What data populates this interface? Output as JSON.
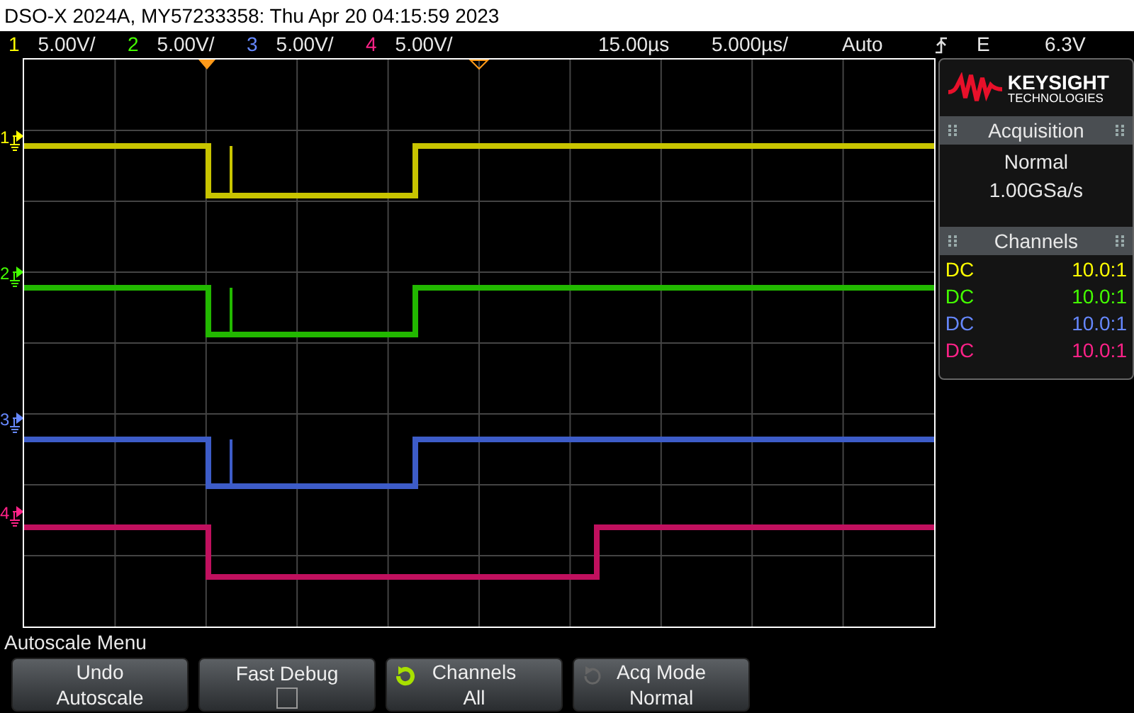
{
  "title_bar": {
    "text": "DSO-X 2024A, MY57233358: Thu Apr 20 04:15:59 2023"
  },
  "channel_bar": {
    "channels": [
      {
        "number": "1",
        "scale": "5.00V/",
        "color": "#ffff00"
      },
      {
        "number": "2",
        "scale": "5.00V/",
        "color": "#44ff00"
      },
      {
        "number": "3",
        "scale": "5.00V/",
        "color": "#6688ff"
      },
      {
        "number": "4",
        "scale": "5.00V/",
        "color": "#ff2288"
      }
    ],
    "delay": "15.00µs",
    "timebase": "5.000µs/",
    "trigger_mode": "Auto",
    "trigger_source": "E",
    "trigger_level": "6.3V"
  },
  "display": {
    "markers": [
      {
        "label": "1",
        "color": "#ffff00"
      },
      {
        "label": "2",
        "color": "#44ff00"
      },
      {
        "label": "3",
        "color": "#6688ff"
      },
      {
        "label": "4",
        "color": "#ff2288"
      }
    ]
  },
  "side_panel": {
    "brand": "KEYSIGHT",
    "brand_subtitle": "TECHNOLOGIES",
    "acquisition": {
      "title": "Acquisition",
      "mode": "Normal",
      "sample_rate": "1.00GSa/s"
    },
    "channels": {
      "title": "Channels",
      "rows": [
        {
          "coupling": "DC",
          "probe": "10.0:1",
          "color": "#ffff00"
        },
        {
          "coupling": "DC",
          "probe": "10.0:1",
          "color": "#44ff00"
        },
        {
          "coupling": "DC",
          "probe": "10.0:1",
          "color": "#6688ff"
        },
        {
          "coupling": "DC",
          "probe": "10.0:1",
          "color": "#ff2288"
        }
      ]
    }
  },
  "menu": {
    "title": "Autoscale Menu",
    "softkeys": [
      {
        "kind": "text",
        "label": "Undo",
        "value": "Autoscale"
      },
      {
        "kind": "checkbox",
        "label": "Fast Debug",
        "checked": false
      },
      {
        "kind": "cycle",
        "label": "Channels",
        "value": "All",
        "enabled": true
      },
      {
        "kind": "cycle",
        "label": "Acq Mode",
        "value": "Normal",
        "enabled": false
      }
    ]
  }
}
